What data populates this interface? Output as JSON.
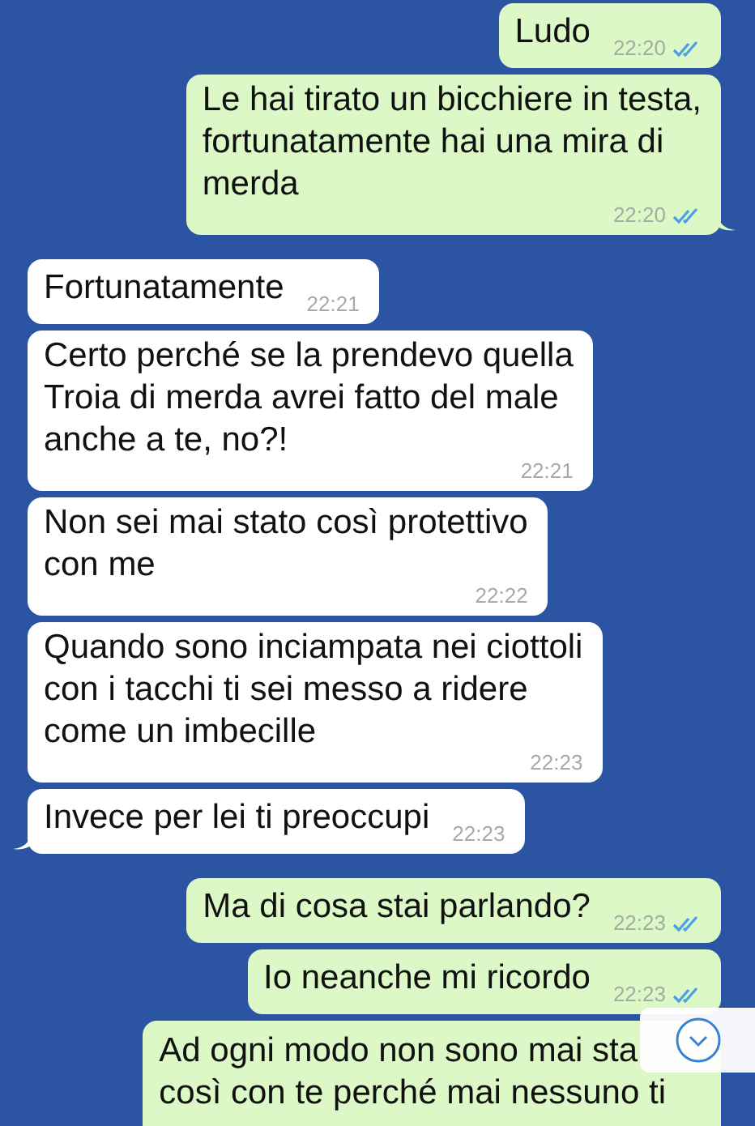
{
  "messages": [
    {
      "kind": "sent",
      "lines": [
        "Ludo"
      ],
      "time": "22:20",
      "read": true,
      "tail": false
    },
    {
      "kind": "sent",
      "lines": [
        "Le hai tirato un bicchiere in testa,",
        "fortunatamente hai una mira di",
        "merda"
      ],
      "time": "22:20",
      "read": true,
      "tail": true
    },
    {
      "kind": "received",
      "lines": [
        "Fortunatamente"
      ],
      "time": "22:21",
      "tail": false
    },
    {
      "kind": "received",
      "lines": [
        "Certo perché se la prendevo quella",
        "Troia di merda avrei fatto del male",
        "anche a te, no?!"
      ],
      "time": "22:21",
      "tail": false
    },
    {
      "kind": "received",
      "lines": [
        "Non sei mai stato così protettivo",
        "con me"
      ],
      "time": "22:22",
      "tail": false
    },
    {
      "kind": "received",
      "lines": [
        "Quando sono inciampata nei ciottoli",
        "con i tacchi ti sei messo a ridere",
        "come un imbecille"
      ],
      "time": "22:23",
      "tail": false
    },
    {
      "kind": "received",
      "lines": [
        "Invece per lei ti preoccupi"
      ],
      "time": "22:23",
      "tail": true
    },
    {
      "kind": "sent",
      "lines": [
        "Ma di cosa stai parlando?"
      ],
      "time": "22:23",
      "read": true,
      "tail": false
    },
    {
      "kind": "sent",
      "lines": [
        "Io neanche mi ricordo"
      ],
      "time": "22:23",
      "read": true,
      "tail": false
    },
    {
      "kind": "sent",
      "lines": [
        "Ad ogni modo non sono mai sta",
        "così con te perché mai nessuno ti"
      ],
      "tail": false
    }
  ],
  "scroll_down_button": true
}
